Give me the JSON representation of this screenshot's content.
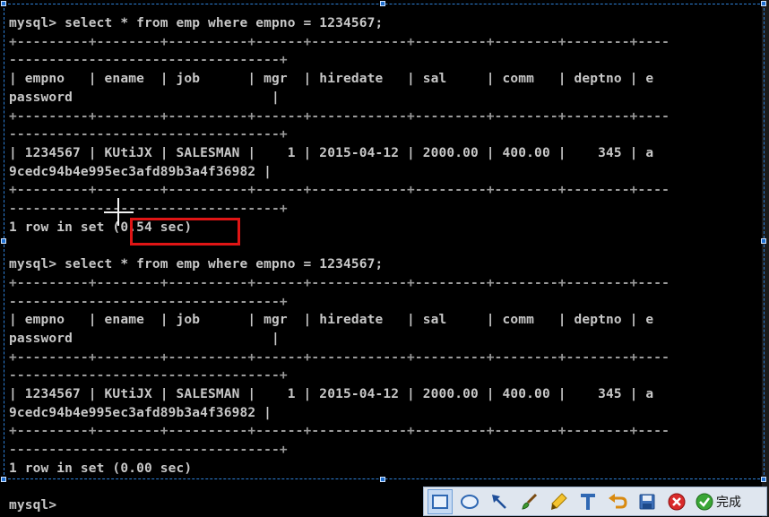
{
  "terminal": {
    "lines": [
      {
        "text": "mysql> select * from emp where empno = 1234567;",
        "kind": "text"
      },
      {
        "text": "+---------+--------+----------+------+------------+---------+--------+--------+----",
        "kind": "sep"
      },
      {
        "text": "----------------------------------+",
        "kind": "sep"
      },
      {
        "text": "| empno   | ename  | job      | mgr  | hiredate   | sal     | comm   | deptno | e",
        "kind": "text"
      },
      {
        "text": "password                         |",
        "kind": "text"
      },
      {
        "text": "+---------+--------+----------+------+------------+---------+--------+--------+----",
        "kind": "sep"
      },
      {
        "text": "----------------------------------+",
        "kind": "sep"
      },
      {
        "text": "| 1234567 | KUtiJX | SALESMAN |    1 | 2015-04-12 | 2000.00 | 400.00 |    345 | a",
        "kind": "text"
      },
      {
        "text": "9cedc94b4e995ec3afd89b3a4f36982 |",
        "kind": "text"
      },
      {
        "text": "+---------+--------+----------+------+------------+---------+--------+--------+----",
        "kind": "sep"
      },
      {
        "text": "----------------------------------+",
        "kind": "sep"
      },
      {
        "text": "1 row in set (0.54 sec)",
        "kind": "text"
      },
      {
        "text": "",
        "kind": "text"
      },
      {
        "text": "mysql> select * from emp where empno = 1234567;",
        "kind": "text"
      },
      {
        "text": "+---------+--------+----------+------+------------+---------+--------+--------+----",
        "kind": "sep"
      },
      {
        "text": "----------------------------------+",
        "kind": "sep"
      },
      {
        "text": "| empno   | ename  | job      | mgr  | hiredate   | sal     | comm   | deptno | e",
        "kind": "text"
      },
      {
        "text": "password                         |",
        "kind": "text"
      },
      {
        "text": "+---------+--------+----------+------+------------+---------+--------+--------+----",
        "kind": "sep"
      },
      {
        "text": "----------------------------------+",
        "kind": "sep"
      },
      {
        "text": "| 1234567 | KUtiJX | SALESMAN |    1 | 2015-04-12 | 2000.00 | 400.00 |    345 | a",
        "kind": "text"
      },
      {
        "text": "9cedc94b4e995ec3afd89b3a4f36982 |",
        "kind": "text"
      },
      {
        "text": "+---------+--------+----------+------+------------+---------+--------+--------+----",
        "kind": "sep"
      },
      {
        "text": "----------------------------------+",
        "kind": "sep"
      },
      {
        "text": "1 row in set (0.00 sec)",
        "kind": "text"
      },
      {
        "text": "",
        "kind": "text"
      },
      {
        "text": "mysql>",
        "kind": "text"
      }
    ]
  },
  "colors": {
    "terminal_bg": "#000000",
    "terminal_text": "#c8c8c8",
    "highlight": "#e01515",
    "selection": "#2d7fd6"
  },
  "toolbar": {
    "tools": [
      {
        "icon": "rectangle-icon",
        "active": true
      },
      {
        "icon": "ellipse-icon",
        "active": false
      },
      {
        "icon": "arrow-icon",
        "active": false
      },
      {
        "icon": "brush-icon",
        "active": false
      },
      {
        "icon": "highlighter-icon",
        "active": false
      },
      {
        "icon": "text-icon",
        "active": false
      },
      {
        "icon": "undo-icon",
        "active": false
      },
      {
        "icon": "save-icon",
        "active": false
      },
      {
        "icon": "cancel-icon",
        "active": false
      }
    ],
    "done_label": "完成",
    "done_icon": "check-icon"
  }
}
